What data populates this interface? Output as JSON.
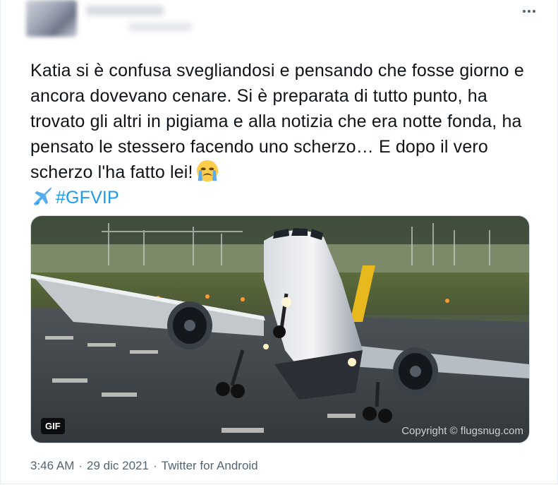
{
  "tweet": {
    "text_main": "Katia si è confusa svegliandosi e pensando che fosse giorno e ancora dovevano cenare. Si è preparata di tutto punto, ha trovato gli altri in pigiama e alla notizia che era notte fonda, ha pensato le stessero facendo uno scherzo… E dopo il vero scherzo l'ha fatto lei!",
    "hashtag": "#GFVIP",
    "media_badge": "GIF",
    "media_watermark": "Copyright © flugsnug.com",
    "time": "3:46 AM",
    "date": "29 dic 2021",
    "source": "Twitter for Android",
    "separator": "·"
  },
  "icons": {
    "more": "more-horizontal-icon",
    "crying_emoji": "loudly-crying-face-icon",
    "airplane_emoji": "airplane-icon"
  },
  "colors": {
    "link": "#1d9bf0",
    "meta_text": "#536471",
    "text": "#0f1419"
  }
}
